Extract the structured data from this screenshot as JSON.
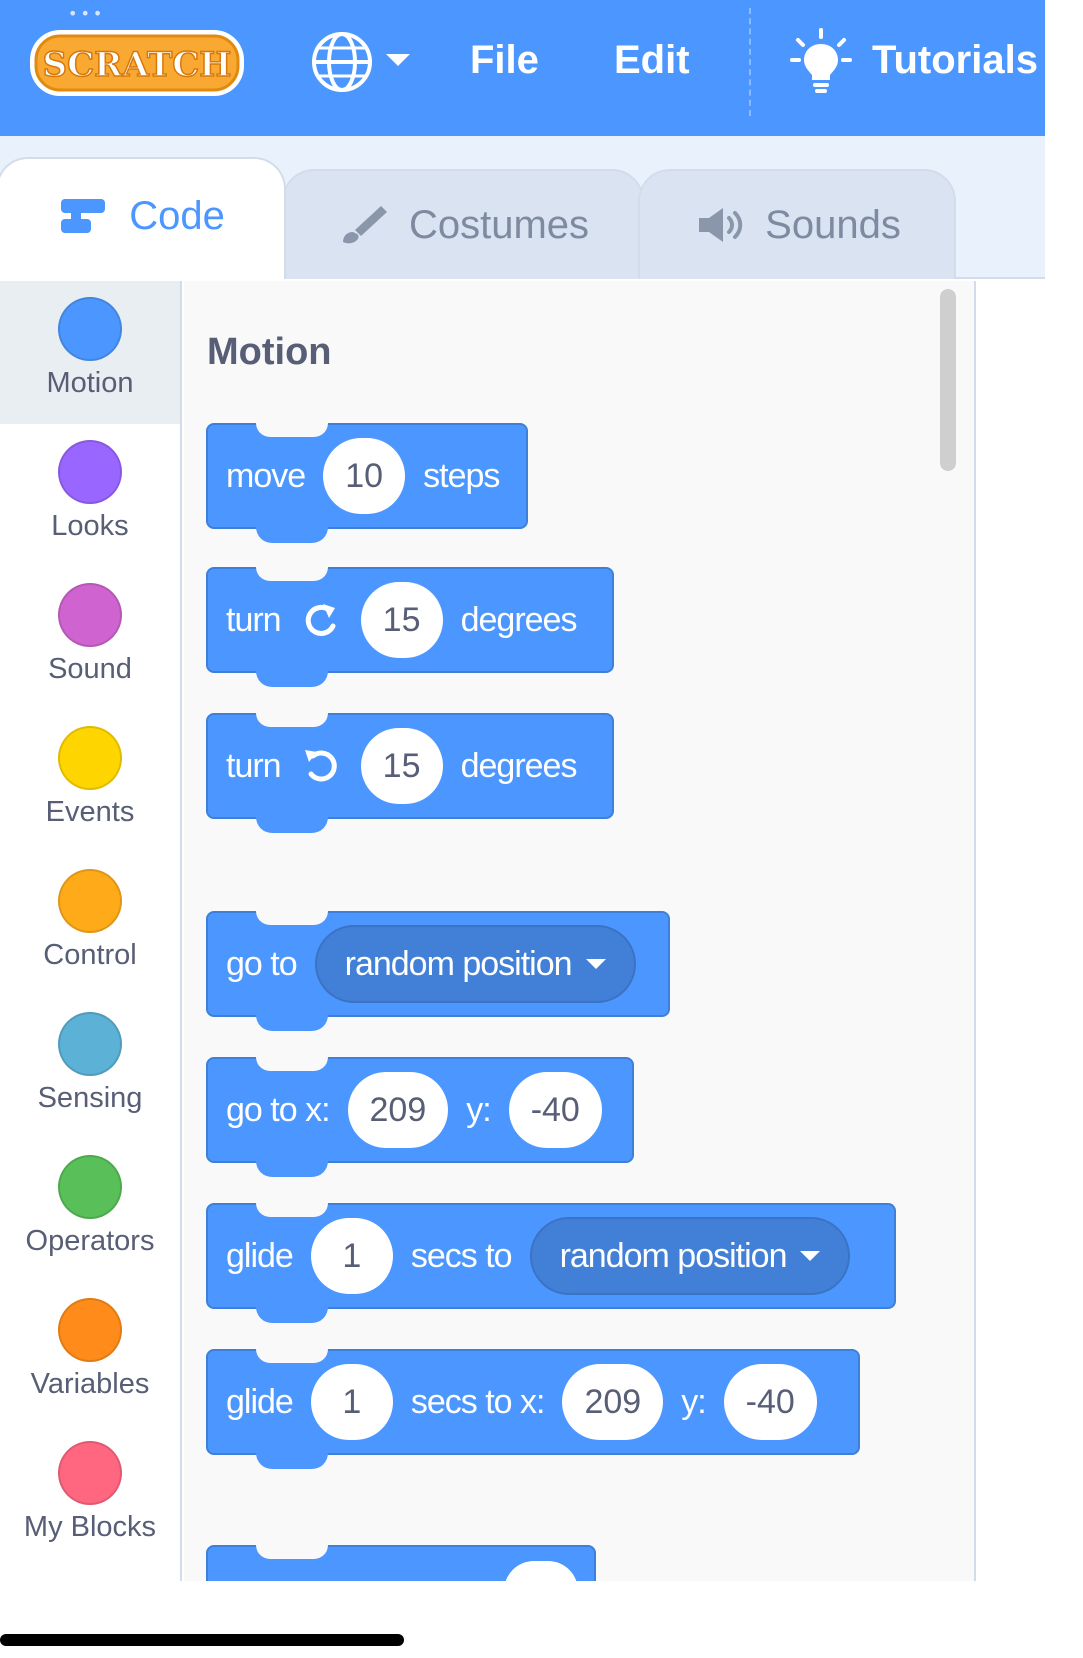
{
  "menubar": {
    "logo_text": "SCRATCH",
    "file_label": "File",
    "edit_label": "Edit",
    "tutorials_label": "Tutorials",
    "brand_color": "#4C97FF"
  },
  "tabs": [
    {
      "label": "Code",
      "icon": "code-icon",
      "active": true
    },
    {
      "label": "Costumes",
      "icon": "brush-icon",
      "active": false
    },
    {
      "label": "Sounds",
      "icon": "speaker-icon",
      "active": false
    }
  ],
  "categories": [
    {
      "label": "Motion",
      "color": "#4C97FF",
      "selected": true
    },
    {
      "label": "Looks",
      "color": "#9966FF"
    },
    {
      "label": "Sound",
      "color": "#CF63CF"
    },
    {
      "label": "Events",
      "color": "#FFD500"
    },
    {
      "label": "Control",
      "color": "#FFAB19"
    },
    {
      "label": "Sensing",
      "color": "#5CB1D6"
    },
    {
      "label": "Operators",
      "color": "#59C059"
    },
    {
      "label": "Variables",
      "color": "#FF8C1A"
    },
    {
      "label": "My Blocks",
      "color": "#FF6680"
    }
  ],
  "palette": {
    "title": "Motion",
    "blocks": {
      "move": {
        "text1": "move",
        "value": "10",
        "text2": "steps"
      },
      "turn_right": {
        "text1": "turn",
        "value": "15",
        "text2": "degrees",
        "icon": "rotate-right-icon"
      },
      "turn_left": {
        "text1": "turn",
        "value": "15",
        "text2": "degrees",
        "icon": "rotate-left-icon"
      },
      "goto": {
        "text1": "go to",
        "dropdown": "random position"
      },
      "goto_xy": {
        "text1": "go to x:",
        "x": "209",
        "text2": "y:",
        "y": "-40"
      },
      "glide": {
        "text1": "glide",
        "secs": "1",
        "text2": "secs to",
        "dropdown": "random position"
      },
      "glide_xy": {
        "text1": "glide",
        "secs": "1",
        "text2": "secs to x:",
        "x": "209",
        "text3": "y:",
        "y": "-40"
      }
    }
  }
}
